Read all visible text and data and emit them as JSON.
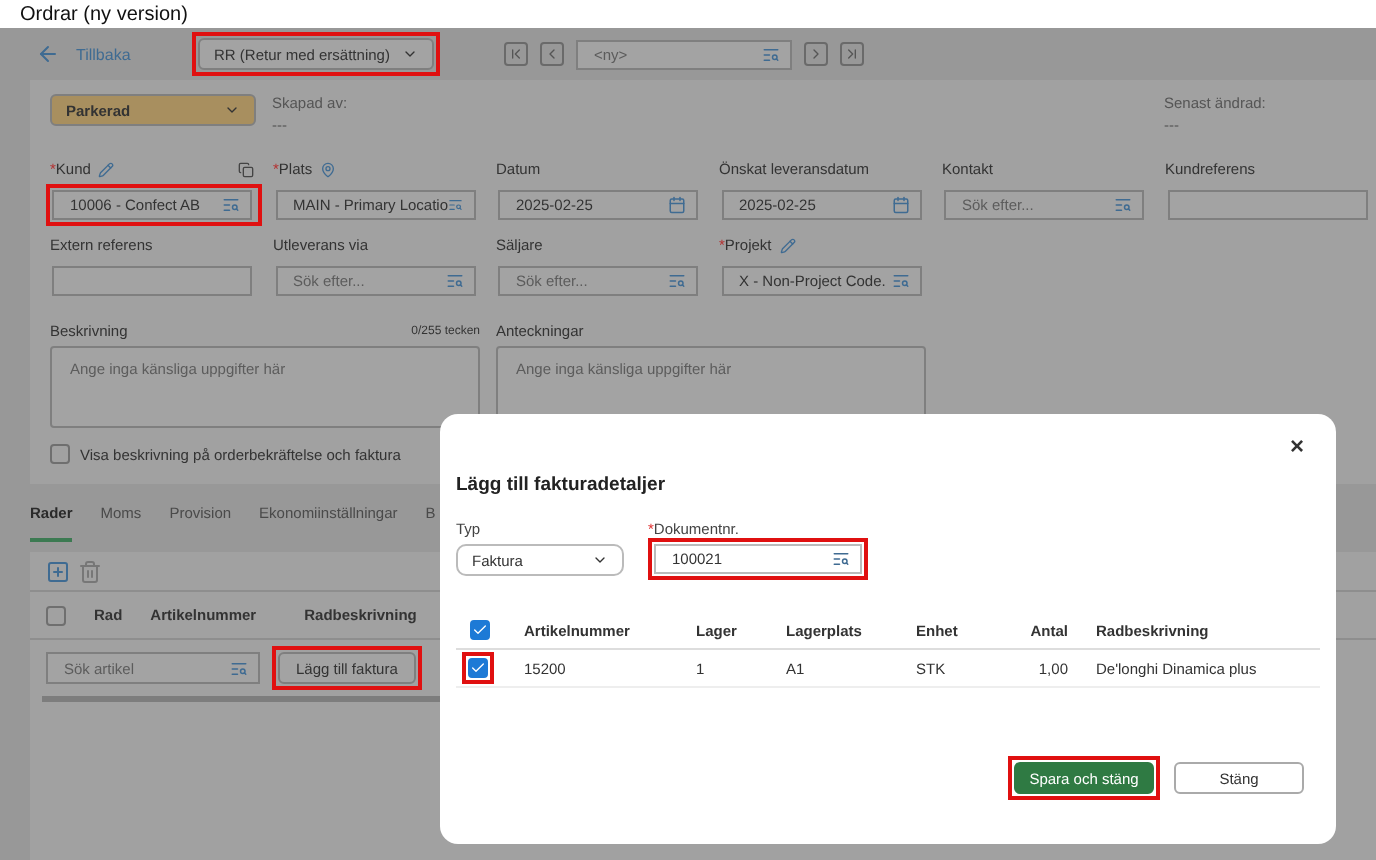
{
  "window": {
    "title": "Ordrar (ny version)"
  },
  "topbar": {
    "back": "Tillbaka",
    "order_type": {
      "value": "RR (Retur med ersättning)",
      "highlighted": true
    },
    "record": {
      "placeholder": "<ny>"
    }
  },
  "status": {
    "value": "Parkerad"
  },
  "meta": [
    {
      "label": "Skapad av:",
      "value": "---"
    },
    {
      "label": "Senast ändrad:",
      "value": "---"
    }
  ],
  "field_rows": [
    [
      {
        "label": "Kund",
        "required_mark": "*",
        "edit_icon": true,
        "location_icon": false,
        "copy_icon": true,
        "kind": "lookup",
        "value": "10006 - Confect AB",
        "highlighted": true
      },
      {
        "label": "Plats",
        "required_mark": "*",
        "edit_icon": false,
        "location_icon": true,
        "copy_icon": false,
        "kind": "lookup",
        "value": "MAIN - Primary Locatio",
        "highlighted": false
      },
      {
        "label": "Datum",
        "edit_icon": false,
        "location_icon": false,
        "copy_icon": false,
        "kind": "date",
        "value": "2025-02-25",
        "highlighted": false
      },
      {
        "label": "Önskat leveransdatum",
        "edit_icon": false,
        "location_icon": false,
        "copy_icon": false,
        "kind": "date",
        "value": "2025-02-25",
        "highlighted": false
      },
      {
        "label": "Kontakt",
        "edit_icon": false,
        "location_icon": false,
        "copy_icon": false,
        "kind": "lookup",
        "placeholder": "Sök efter...",
        "highlighted": false
      },
      {
        "label": "Kundreferens",
        "edit_icon": false,
        "location_icon": false,
        "copy_icon": false,
        "kind": "text",
        "highlighted": false
      }
    ],
    [
      {
        "label": "Extern referens",
        "edit_icon": false,
        "location_icon": false,
        "copy_icon": false,
        "kind": "text",
        "highlighted": false
      },
      {
        "label": "Utleverans via",
        "edit_icon": false,
        "location_icon": false,
        "copy_icon": false,
        "kind": "lookup",
        "placeholder": "Sök efter...",
        "highlighted": false
      },
      {
        "label": "Säljare",
        "edit_icon": false,
        "location_icon": false,
        "copy_icon": false,
        "kind": "lookup",
        "placeholder": "Sök efter...",
        "highlighted": false
      },
      {
        "label": "Projekt",
        "required_mark": "*",
        "edit_icon": true,
        "location_icon": false,
        "copy_icon": false,
        "kind": "lookup",
        "value": "X - Non-Project Code.",
        "highlighted": false
      }
    ]
  ],
  "description": {
    "label": "Beskrivning",
    "counter": "0/255 tecken",
    "placeholder": "Ange inga känsliga uppgifter här"
  },
  "notes": {
    "label": "Anteckningar",
    "placeholder": "Ange inga känsliga uppgifter här"
  },
  "show_description": {
    "label": "Visa beskrivning på orderbekräftelse och faktura",
    "checked": false
  },
  "tabs": [
    {
      "label": "Rader",
      "selected": true
    },
    {
      "label": "Moms",
      "selected": false
    },
    {
      "label": "Provision",
      "selected": false
    },
    {
      "label": "Ekonomiinställningar",
      "selected": false
    },
    {
      "label": "B",
      "selected": false
    }
  ],
  "lines_table": {
    "all_checked": false,
    "columns": [
      "Rad",
      "Artikelnummer",
      "Radbeskrivning"
    ],
    "search": {
      "placeholder": "Sök artikel"
    },
    "add_invoice_button": {
      "label": "Lägg till faktura",
      "highlighted": true
    }
  },
  "dialog": {
    "title": "Lägg till fakturadetaljer",
    "close": "×",
    "type": {
      "label": "Typ",
      "value": "Faktura"
    },
    "document": {
      "label": "Dokumentnr.",
      "required_mark": "*",
      "value": "100021",
      "highlighted": true
    },
    "all_checked": true,
    "columns": [
      "Artikelnummer",
      "Lager",
      "Lagerplats",
      "Enhet",
      "Antal",
      "Radbeskrivning"
    ],
    "rows": [
      {
        "checked": true,
        "highlighted": true,
        "cells": [
          "15200",
          "1",
          "A1",
          "STK",
          "1,00",
          "De'longhi Dinamica plus"
        ]
      }
    ],
    "buttons": [
      {
        "label": "Spara och stäng",
        "kind": "primary",
        "highlighted": true
      },
      {
        "label": "Stäng",
        "kind": "secondary",
        "highlighted": false
      }
    ]
  }
}
